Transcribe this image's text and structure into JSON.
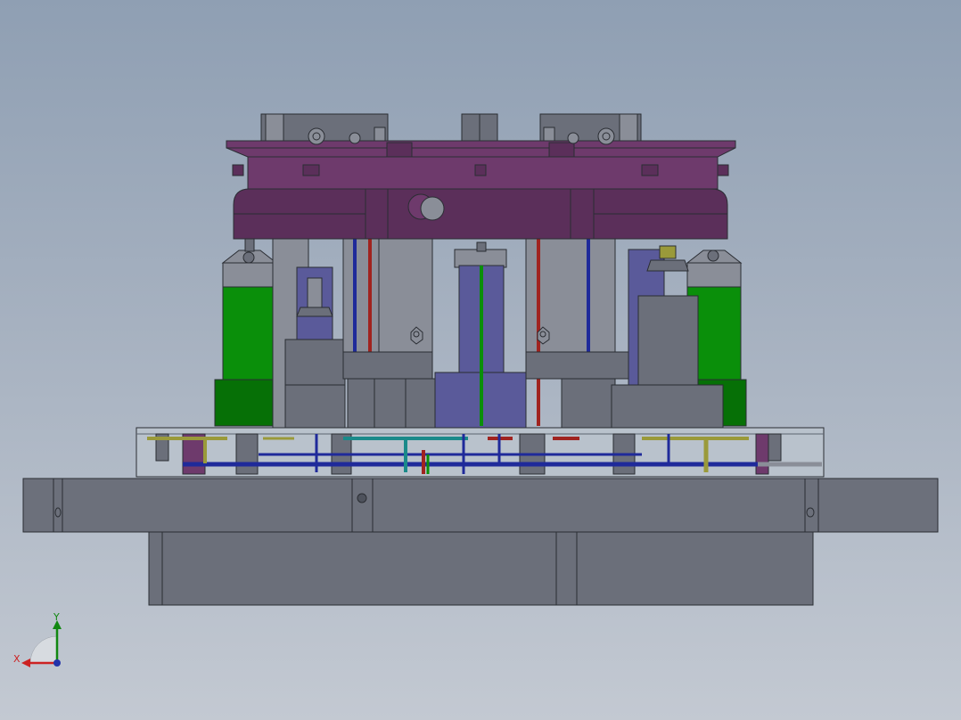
{
  "viewport": {
    "background_top": "#8f9fb3",
    "background_bottom": "#c3c9d2"
  },
  "colors": {
    "steel": "#6b6f7a",
    "steel_dark": "#4e525c",
    "steel_light": "#8a8e98",
    "purple": "#5b2f5a",
    "purple_light": "#6e3a6c",
    "green": "#0a8f0a",
    "green_dark": "#067006",
    "blue_pipe": "#1f2a9a",
    "red_pipe": "#a0231f",
    "teal_pipe": "#1a8a8a",
    "olive_pipe": "#9a9a3a",
    "glass": "#b9c2cc",
    "outline": "#2a2d33"
  },
  "triad": {
    "x_label": "X",
    "y_label": "Y",
    "x_color": "#cc2222",
    "y_color": "#118811",
    "z_color": "#2233aa"
  }
}
